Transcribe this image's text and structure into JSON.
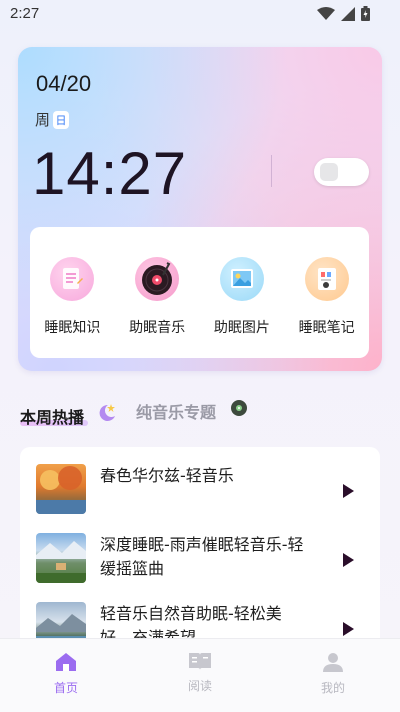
{
  "status_bar": {
    "time": "2:27"
  },
  "header": {
    "date": "04/20",
    "weekday_prefix": "周",
    "weekday_badge": "日",
    "clock": "14:27",
    "toggle_on": false
  },
  "shortcuts": [
    {
      "label": "睡眠知识",
      "icon": "notebook-icon"
    },
    {
      "label": "助眠音乐",
      "icon": "vinyl-record-icon"
    },
    {
      "label": "助眠图片",
      "icon": "picture-icon"
    },
    {
      "label": "睡眠笔记",
      "icon": "note-icon"
    }
  ],
  "tabs": {
    "active": "本周热播",
    "inactive": "纯音乐专题"
  },
  "playlist": [
    {
      "title": "春色华尔兹-轻音乐"
    },
    {
      "title": "深度睡眠-雨声催眠轻音乐-轻缓摇篮曲"
    },
    {
      "title": "轻音乐自然音助眠-轻松美好，充满希望"
    }
  ],
  "bottom_nav": [
    {
      "label": "首页",
      "active": true
    },
    {
      "label": "阅读",
      "active": false
    },
    {
      "label": "我的",
      "active": false
    }
  ],
  "colors": {
    "accent": "#9b6cf0",
    "nav_inactive": "#b8b8c0",
    "play_icon": "#2a0e2a"
  }
}
